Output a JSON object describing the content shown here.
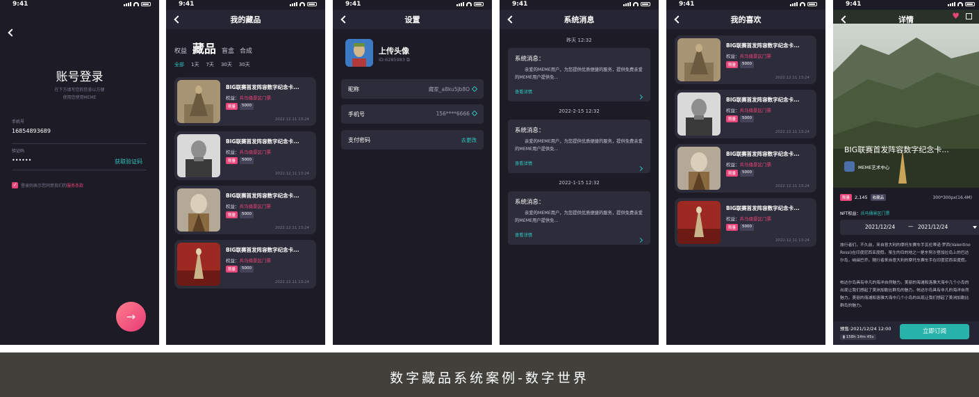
{
  "status_time": "9:41",
  "login": {
    "title": "账号登录",
    "subtitle_line1": "在下方填写您的信息以方便",
    "subtitle_line2": "使用您使用MEME",
    "phone_label": "手机号",
    "phone_value": "16854893689",
    "code_label": "验证码",
    "code_value": "••••••",
    "get_code": "获取验证码",
    "agree_text": "登录则表示您同意我们的",
    "agree_link": "服务条款"
  },
  "collection": {
    "title": "我的藏品",
    "tabs": [
      "权益",
      "藏品",
      "盲盒",
      "合成"
    ],
    "filters": [
      "全部",
      "1天",
      "7天",
      "30天",
      "30天"
    ],
    "cards": [
      {
        "title": "BIG联赛首发阵容数字纪念卡...",
        "right_label": "权益：",
        "right_value": "兵马俑景区门票",
        "tag1": "限量",
        "tag2": "5000",
        "date": "2022.12.11 13:24"
      },
      {
        "title": "BIG联赛首发阵容数字纪念卡...",
        "right_label": "权益：",
        "right_value": "兵马俑景区门票",
        "tag1": "限量",
        "tag2": "5000",
        "date": "2022.12.11 13:24"
      },
      {
        "title": "BIG联赛首发阵容数字纪念卡...",
        "right_label": "权益：",
        "right_value": "兵马俑景区门票",
        "tag1": "限量",
        "tag2": "5000",
        "date": "2022.12.11 13:24"
      },
      {
        "title": "BIG联赛首发阵容数字纪念卡...",
        "right_label": "权益：",
        "right_value": "兵马俑景区门票",
        "tag1": "限量",
        "tag2": "5000",
        "date": "2022.12.11 13:24"
      }
    ]
  },
  "settings": {
    "title": "设置",
    "avatar_title": "上传头像",
    "avatar_id": "ID:6285983",
    "rows": [
      {
        "label": "昵称",
        "value": "藏家_a8ku5jb8O"
      },
      {
        "label": "手机号",
        "value": "156****6666"
      },
      {
        "label": "支付密码",
        "value": "去更改"
      }
    ]
  },
  "messages": {
    "title": "系统消息",
    "items": [
      {
        "date": "昨天 12:32",
        "title": "系统消息：",
        "body": "亲爱的MEME用户，为您提供优质便捷的服务，提供免费亲爱的MEME用户提供免...",
        "link": "查看详情"
      },
      {
        "date": "2022-2-15 12:32",
        "title": "系统消息：",
        "body": "亲爱的MEME用户，为您提供优质便捷的服务，提供免费亲爱的MEME用户提供免...",
        "link": "查看详情"
      },
      {
        "date": "2022-1-15 12:32",
        "title": "系统消息：",
        "body": "亲爱的MEME用户，为您提供优质便捷的服务，提供免费亲爱的MEME用户提供免...",
        "link": "查看详情"
      }
    ]
  },
  "favorites": {
    "title": "我的喜欢",
    "cards": [
      {
        "title": "BIG联赛首发阵容数字纪念卡...",
        "right_label": "权益：",
        "right_value": "兵马俑景区门票",
        "tag1": "限量",
        "tag2": "5000",
        "date": "2022.12.11 13:24"
      },
      {
        "title": "BIG联赛首发阵容数字纪念卡...",
        "right_label": "权益：",
        "right_value": "兵马俑景区门票",
        "tag1": "限量",
        "tag2": "5000",
        "date": "2022.12.11 13:24"
      },
      {
        "title": "BIG联赛首发阵容数字纪念卡...",
        "right_label": "权益：",
        "right_value": "兵马俑景区门票",
        "tag1": "限量",
        "tag2": "5000",
        "date": "2022.12.11 13:24"
      },
      {
        "title": "BIG联赛首发阵容数字纪念卡...",
        "right_label": "权益：",
        "right_value": "兵马俑景区门票",
        "tag1": "限量",
        "tag2": "5000",
        "date": "2022.12.11 13:24"
      }
    ]
  },
  "detail": {
    "title": "详情",
    "hero_title": "BIG联赛首发阵容数字纪念卡...",
    "creator": "MEME艺术中心",
    "tag_limit": "限量",
    "count": "2,145",
    "tag_collect": "收藏品",
    "size": "300*300px(16.4M)",
    "nft_label": "NFT权益：",
    "nft_value": "兵马俑景区门票",
    "date_from": "2021/12/24",
    "date_sep": "—",
    "date_to": "2021/12/24",
    "para1": "旅行者们，不久前，来自意大利的摩托车赛车手瓦伦蒂诺·罗西(Valentino Rossi)在印度尼西亚度假。虽生的目的地之一是东努沙登加拉岛上的巴达尔岛，纳闽巴乔。随行者来自意大利的摩托车赛车手在印度尼西亚度假。",
    "para2": "帕达尔岛具有非凡的海洋自然魅力。美丽的海滩和洛雅大海中几个小岛的出现让我们想起了美洲加勒比群岛的魅力。帕达尔岛具有非凡的海洋自然魅力。美丽的海滩和洛雅大海中几个小岛的出现让我们想起了美洲加勒比群岛的魅力。",
    "presale": "预售:2021/12/24 12:00",
    "countdown": "158h 14m 45s",
    "order_button": "立即订阅"
  },
  "footer": {
    "caption": "数字藏品系统案例-数字世界"
  },
  "colors": {
    "bg": "#1c1b26",
    "card": "#2d2c3a",
    "accent_teal": "#2fc4be",
    "accent_pink": "#e8457a",
    "footer": "#41403a"
  }
}
